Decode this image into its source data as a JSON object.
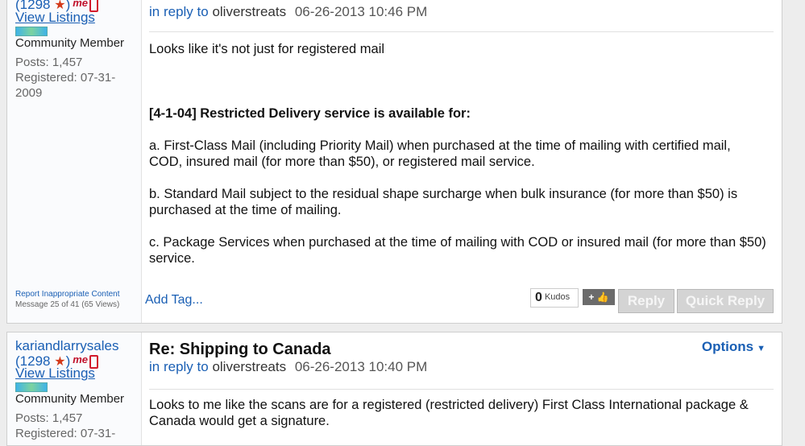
{
  "posts": [
    {
      "author": "",
      "rating": "1298",
      "me_badge": "me",
      "view_listings": "View Listings",
      "role": "Community Member",
      "posts": "Posts: 1,457",
      "registered_a": "Registered: 07-31-",
      "registered_b": "2009",
      "in_reply_to": "in reply to",
      "reply_user": "oliverstreats",
      "date": "06-26-2013 10:46 PM",
      "body": [
        "Looks like it's not just for registered mail",
        "[4-1-04] Restricted Delivery service is available for:",
        "a. First-Class Mail (including Priority Mail) when purchased at the time of mailing with certified mail, COD, insured mail (for more than $50), or registered mail service.",
        "b. Standard Mail subject to the residual shape surcharge when bulk insurance (for more than $50) is purchased at the time of mailing.",
        "c. Package Services when purchased at the time of mailing with COD or insured mail (for more than $50) service."
      ],
      "report": "Report Inappropriate Content",
      "message_count": "Message 25 of 41 (65 Views)",
      "add_tag": "Add Tag...",
      "kudos_count": "0",
      "kudos_label": "Kudos",
      "kudos_plus": "+",
      "reply_label": "Reply",
      "quick_reply_label": "Quick Reply"
    },
    {
      "author": "kariandlarrysales",
      "rating": "1298",
      "me_badge": "me",
      "view_listings": "View Listings",
      "role": "Community Member",
      "posts": "Posts: 1,457",
      "registered_a": "Registered: 07-31-",
      "title": "Re: Shipping to Canada",
      "options_label": "Options",
      "in_reply_to": "in reply to",
      "reply_user": "oliverstreats",
      "date": "06-26-2013 10:40 PM",
      "body": [
        "Looks to me like the scans are for a registered (restricted delivery) First Class International package & Canada would get a signature."
      ]
    }
  ],
  "icons": {
    "star": "star-icon",
    "phone": "phone-icon",
    "thumbs_up": "thumbs-up-icon",
    "caret": "chevron-down-icon"
  },
  "colors": {
    "link": "#1a5fb4",
    "star": "#d43a1a",
    "me_badge": "#c0102a",
    "disabled_button": "#d4d4d4"
  }
}
